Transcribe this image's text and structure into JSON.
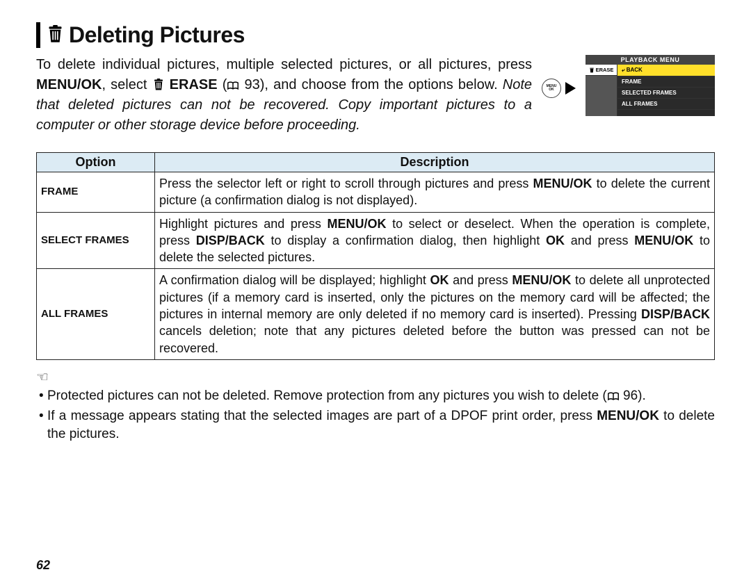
{
  "title": "Deleting Pictures",
  "intro": {
    "p1a": "To delete individual pictures, multiple selected pictures, or all pictures, press ",
    "menuok": "MENU/OK",
    "p1b": ", select ",
    "erase": " ERASE",
    "p1c": " (",
    "pref": " 93), and choose from the options below.  ",
    "ital": "Note that deleted pictures can not be recovered.  Copy important pictures to a computer or other storage device before proceeding."
  },
  "cam_menu": {
    "head": "PLAYBACK MENU",
    "tab_icon_label": "ERASE",
    "rows": [
      "BACK",
      "FRAME",
      "SELECTED FRAMES",
      "ALL FRAMES"
    ]
  },
  "menuok_small": "MENU\nOK",
  "table": {
    "h_option": "Option",
    "h_desc": "Description",
    "rows": [
      {
        "label": "FRAME",
        "desc_a": "Press the selector left or right to scroll through pictures and press ",
        "b1": "MENU/OK",
        "desc_b": " to delete the current picture (a confirmation dialog is not displayed)."
      },
      {
        "label": "SELECT FRAMES",
        "desc_a": "Highlight pictures and press ",
        "b1": "MENU/OK",
        "desc_b": " to select or deselect. When the operation is complete, press ",
        "b2": "DISP/BACK",
        "desc_c": " to display a confirmation dialog, then highlight ",
        "b3": "OK",
        "desc_d": " and press ",
        "b4": "MENU/OK",
        "desc_e": " to delete the selected pictures."
      },
      {
        "label": "ALL FRAMES",
        "desc_a": "A confirmation dialog will be displayed; highlight ",
        "b1": "OK",
        "desc_b": " and press ",
        "b2": "MENU/OK",
        "desc_c": " to delete all unprotected pictures (if a memory card is inserted, only the pictures on the memory card will be affected; the pictures in internal memory are only deleted if no memory card is inserted).  Pressing ",
        "b3": "DISP/BACK",
        "desc_d": " cancels deletion; note that any pictures deleted before the button was pressed can not be recovered."
      }
    ]
  },
  "notes": {
    "n1a": "Protected pictures can not be deleted.  Remove protection from any pictures you wish to delete (",
    "n1b": " 96).",
    "n2a": "If a message appears stating that the selected images are part of a DPOF print order, press ",
    "n2b": "MENU/OK",
    "n2c": " to delete the pictures."
  },
  "page_number": "62"
}
